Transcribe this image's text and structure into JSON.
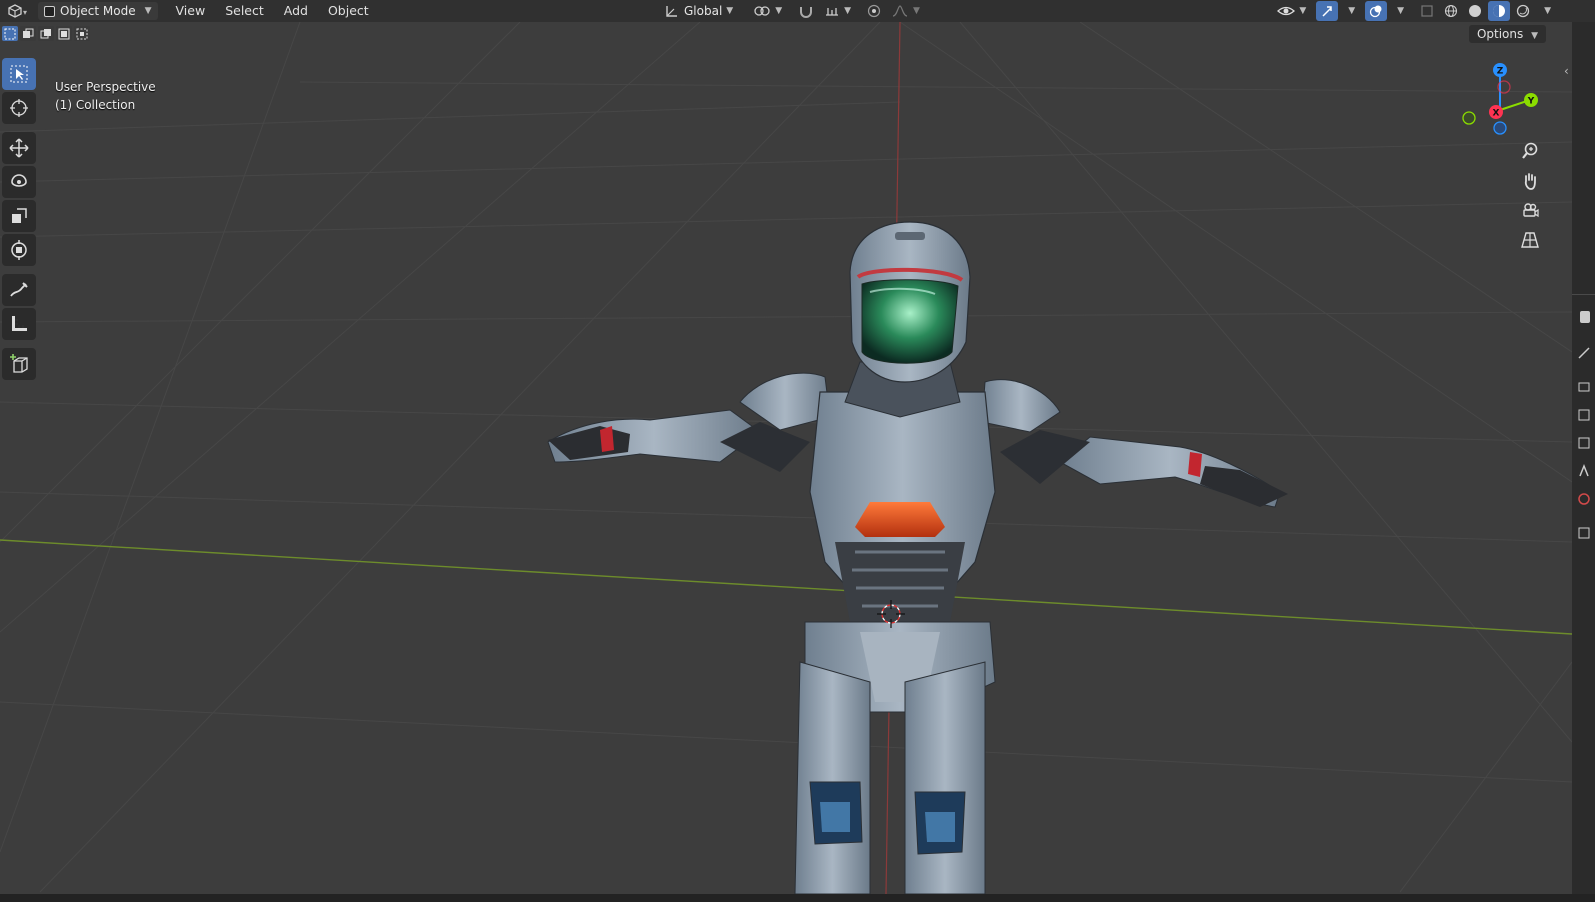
{
  "header": {
    "editor_type_icon": "3d-viewport-icon",
    "mode": "Object Mode",
    "menus": [
      "View",
      "Select",
      "Add",
      "Object"
    ],
    "transform_orientation": "Global"
  },
  "viewport": {
    "view_name": "User Perspective",
    "collection": "(1) Collection",
    "options_label": "Options"
  },
  "gizmo": {
    "z": "Z",
    "y": "Y",
    "x": "X"
  },
  "colors": {
    "accent": "#4772b3",
    "x_axis": "#ff3352",
    "y_axis": "#8bdc00",
    "z_axis": "#2890ff",
    "background": "#3d3d3d"
  }
}
